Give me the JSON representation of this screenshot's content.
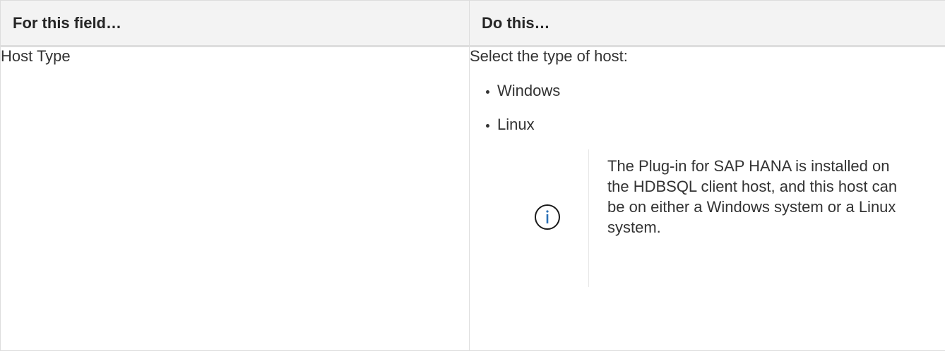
{
  "table": {
    "headers": [
      "For this field…",
      "Do this…"
    ],
    "row": {
      "field": "Host Type",
      "instruction": "Select the type of host:",
      "options": [
        "Windows",
        "Linux"
      ],
      "note": {
        "icon": "info-icon",
        "text": "The Plug-in for SAP HANA is installed on the HDBSQL client host, and this host can be on either a Windows system or a Linux system."
      }
    }
  },
  "colors": {
    "header_bg": "#f3f3f3",
    "border": "#dddddd",
    "text": "#333333",
    "icon": "#1a1a1a"
  }
}
